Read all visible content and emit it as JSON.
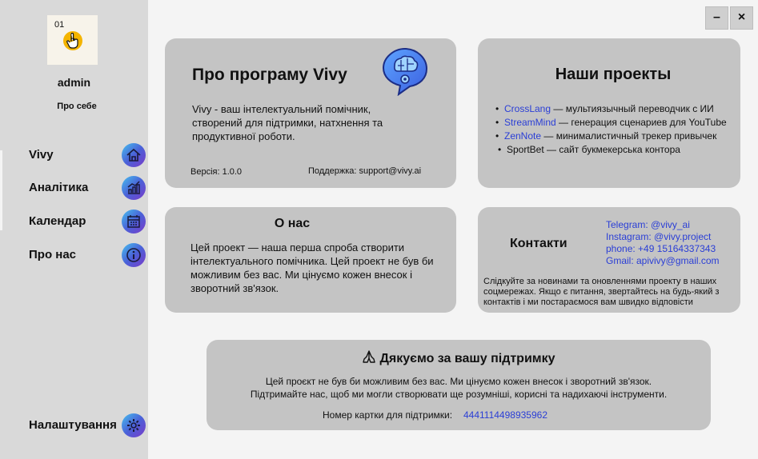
{
  "sidebar": {
    "avatar_number": "01",
    "username": "admin",
    "about_self": "Про себе",
    "nav": [
      {
        "label": "Vivy",
        "icon": "home-icon"
      },
      {
        "label": "Аналітика",
        "icon": "chart-icon"
      },
      {
        "label": "Календар",
        "icon": "calendar-icon"
      },
      {
        "label": "Про нас",
        "icon": "info-icon"
      }
    ],
    "settings": {
      "label": "Налаштування",
      "icon": "gear-icon"
    }
  },
  "window": {
    "minimize": "–",
    "close": "×"
  },
  "about_program": {
    "title": "Про програму Vivy",
    "description": "Vivy - ваш інтелектуальний помічник, створений для підтримки, натхнення та продуктивної роботи.",
    "version": "Версія: 1.0.0",
    "support": "Поддержка: support@vivy.ai",
    "icon": "brain-icon"
  },
  "projects": {
    "title": "Наши проекты",
    "items": [
      {
        "name": "CrossLang",
        "desc": " — мультиязычный переводчик с ИИ",
        "linked": true
      },
      {
        "name": "StreamMind",
        "desc": " — генерация сценариев для YouTube",
        "linked": true
      },
      {
        "name": "ZenNote",
        "desc": " — минималистичный трекер привычек",
        "linked": true
      },
      {
        "name": "SportBet",
        "desc": " — сайт букмекерська контора",
        "linked": false
      }
    ]
  },
  "about_us": {
    "title": "О нас",
    "text": "Цей проект — наша перша спроба створити інтелектуального помічника. Цей проект не був би можливим без вас. Ми цінуємо кожен внесок і зворотний зв'язок."
  },
  "contacts": {
    "title": "Контакти",
    "links": [
      "Telegram: @vivy_ai",
      "Instagram: @vivy.project",
      "phone: +49 15164337343",
      "Gmail: apivivy@gmail.com"
    ],
    "note": "Слідкуйте за новинами та оновленнями проекту в наших соцмережах. Якщо є питання, звертайтесь на будь-який з контактів і ми постараємося вам швидко відповісти"
  },
  "thanks": {
    "title": "Дякуємо за вашу підтримку",
    "icon": "praying-hands-icon",
    "line1": "Цей проєкт не був би можливим без вас. Ми цінуємо кожен внесок і зворотний зв'язок.",
    "line2": "Підтримайте нас, щоб ми могли створювати ще розумніші, корисні та надихаючі інструменти.",
    "card_label": "Номер картки для підтримки:",
    "card_number": "4441114498935962"
  }
}
